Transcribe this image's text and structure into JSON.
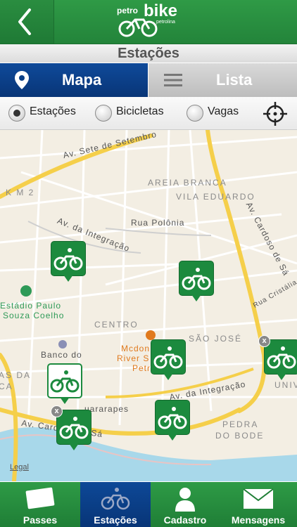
{
  "header": {
    "logo_petro": "petro",
    "logo_bike": "bike",
    "logo_sub": "petrolina"
  },
  "page_title": "Estações",
  "segments": {
    "mapa": "Mapa",
    "lista": "Lista"
  },
  "filters": {
    "estacoes": "Estações",
    "bicicletas": "Bicicletas",
    "vagas": "Vagas"
  },
  "map": {
    "labels": {
      "sete_setembro": "Av. Sete de Setembro",
      "km2": "K M 2",
      "areia_branca": "AREIA BRANCA",
      "vila_eduardo": "VILA EDUARDO",
      "integracao1": "Av. da Integração",
      "polonia": "Rua Polônia",
      "cardoso_sa": "Av. Cardoso de Sá",
      "cristalia": "Rua Cristália",
      "estadio": "Estádio Paulo",
      "estadio2": "Souza Coelho",
      "centro": "CENTRO",
      "sao_jose": "SÃO JOSÉ",
      "banco": "Banco do",
      "mcdonalds": "Mcdon",
      "river": "River S",
      "petro_small": "Petro",
      "integracao2": "Av. da Integração",
      "guararapes": "uararapes",
      "cardoso_sa2": "Av. Cardoso de Sá",
      "pedra": "PEDRA",
      "do_bode": "DO BODE",
      "univ": "UNIV",
      "as_da": "AS DA",
      "ca": "CA"
    },
    "legal": "Legal"
  },
  "tabs": {
    "passes": "Passes",
    "estacoes": "Estações",
    "cadastro": "Cadastro",
    "mensagens": "Mensagens"
  }
}
